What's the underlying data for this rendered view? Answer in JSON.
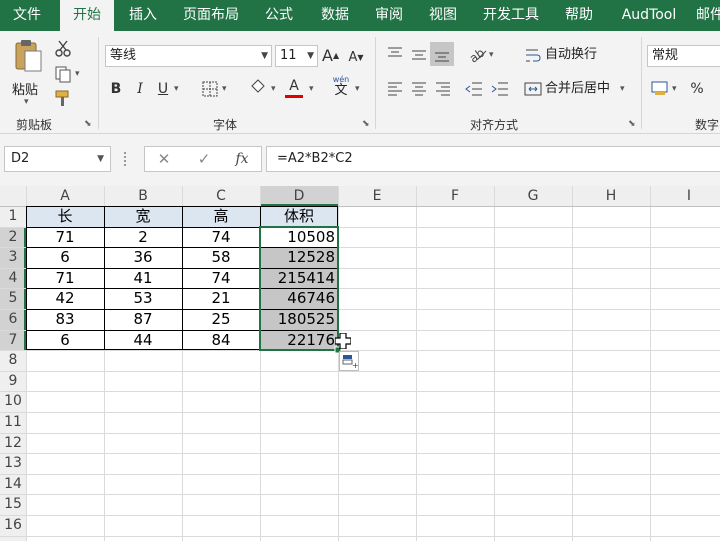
{
  "ribbon_tabs": [
    "文件",
    "开始",
    "插入",
    "页面布局",
    "公式",
    "数据",
    "审阅",
    "视图",
    "开发工具",
    "帮助",
    "AudTool",
    "邮件"
  ],
  "clipboard": {
    "paste_label": "粘贴",
    "group_label": "剪贴板"
  },
  "font": {
    "name": "等线",
    "size": "11",
    "group_label": "字体",
    "bold": "B",
    "italic": "I",
    "underline": "U",
    "grow": "A",
    "shrink": "A",
    "phonetic_top": "wén",
    "phonetic_bottom": "文"
  },
  "alignment": {
    "wrap_label": "自动换行",
    "merge_label": "合并后居中",
    "group_label": "对齐方式"
  },
  "number": {
    "format": "常规",
    "group_label": "数字",
    "percent": "%"
  },
  "name_box": "D2",
  "formula": "=A2*B2*C2",
  "formula_buttons": {
    "cancel": "✕",
    "enter": "✓",
    "function": "fx"
  },
  "columns": [
    "A",
    "B",
    "C",
    "D",
    "E",
    "F",
    "G",
    "H",
    "I"
  ],
  "rows": [
    "1",
    "2",
    "3",
    "4",
    "5",
    "6",
    "7",
    "8",
    "9",
    "10",
    "11",
    "12",
    "13",
    "14",
    "15",
    "16"
  ],
  "table": {
    "headers": [
      "长",
      "宽",
      "高",
      "体积"
    ],
    "rows": [
      [
        "71",
        "2",
        "74",
        "10508"
      ],
      [
        "6",
        "36",
        "58",
        "12528"
      ],
      [
        "71",
        "41",
        "74",
        "215414"
      ],
      [
        "42",
        "53",
        "21",
        "46746"
      ],
      [
        "83",
        "87",
        "25",
        "180525"
      ],
      [
        "6",
        "44",
        "84",
        "22176"
      ]
    ]
  },
  "colors": {
    "excel_green": "#217346",
    "header_fill": "#dce6f1",
    "selection_fill": "#c6c6c6",
    "selection_border": "#217346"
  }
}
